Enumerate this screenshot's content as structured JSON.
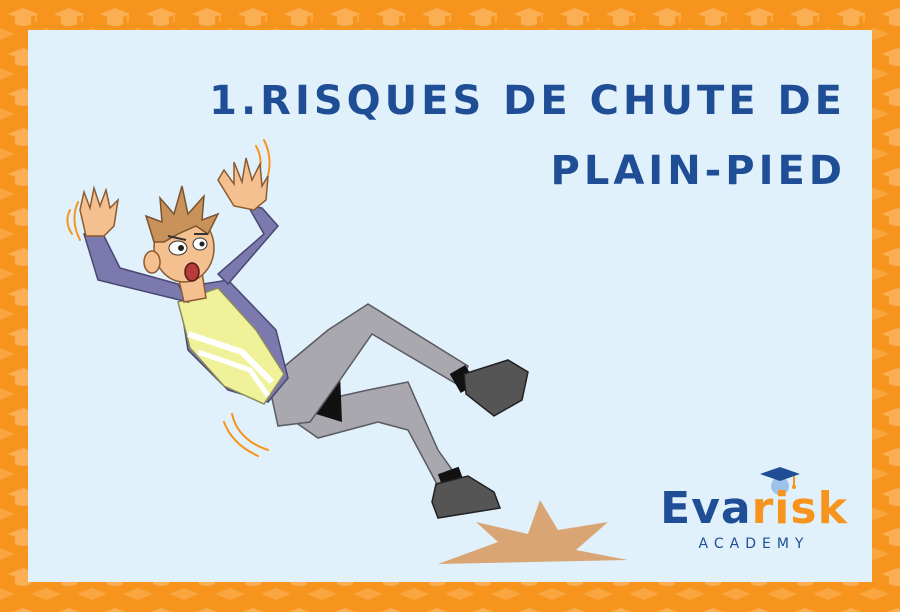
{
  "title": {
    "line1": "1.RISQUES DE CHUTE DE",
    "line2": "PLAIN-PIED"
  },
  "logo": {
    "word_part1": "Eva",
    "word_part2": "risk",
    "subtitle": "ACADEMY"
  },
  "colors": {
    "frame_orange": "#f7941d",
    "panel_bg": "#e1f1fb",
    "title_blue": "#1f4e96",
    "vest_yellow": "#f0f29a",
    "sleeve_purple": "#7b79ae",
    "pants_gray": "#a8a8ae"
  },
  "icons": {
    "border_pattern": "graduation-cap-icon",
    "logo_mark": "graduation-cap-icon"
  }
}
